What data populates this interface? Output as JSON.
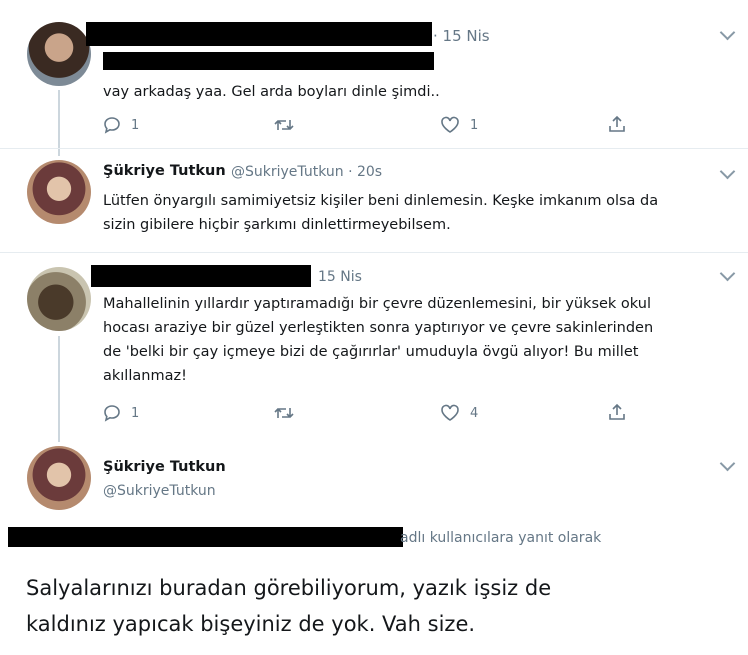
{
  "tweets": [
    {
      "date": "· 15 Nis",
      "text": "vay arkadaş yaa. Gel arda boyları dinle şimdi..",
      "reply_count": "1",
      "like_count": "1"
    },
    {
      "name": "Şükriye Tutkun",
      "handle_time": "@SukriyeTutkun · 20s",
      "text_lines": [
        "Lütfen önyargılı samimiyetsiz kişiler beni dinlemesin. Keşke imkanım olsa da",
        "sizin gibilere hiçbir şarkımı dinlettirmeyebilsem."
      ]
    },
    {
      "date": "15 Nis",
      "text_lines": [
        "Mahallelinin yıllardır yaptıramadığı bir çevre düzenlemesini, bir yüksek okul",
        "hocası araziye bir güzel yerleştikten sonra yaptırıyor ve çevre sakinlerinden",
        "de 'belki bir çay içmeye bizi de çağırırlar' umuduyla övgü alıyor! Bu millet",
        "akıllanmaz!"
      ],
      "reply_count": "1",
      "like_count": "4"
    },
    {
      "name": "Şükriye Tutkun",
      "handle": "@SukriyeTutkun",
      "reply_to": "adlı kullanıcılara yanıt olarak",
      "text_lines": [
        "Salyalarınızı buradan görebiliyorum, yazık işsiz de",
        "kaldınız yapıcak bişeyiniz de yok. Vah size."
      ]
    }
  ]
}
